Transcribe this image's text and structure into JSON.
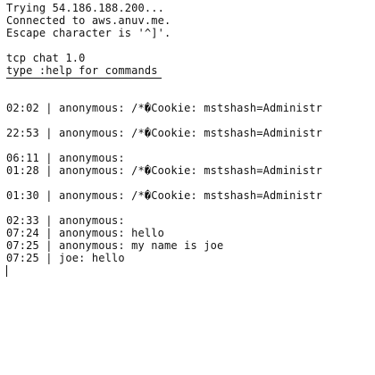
{
  "connection": {
    "trying": "Trying 54.186.188.200...",
    "connected": "Connected to aws.anuv.me.",
    "escape": "Escape character is '^]'."
  },
  "banner": {
    "title": "tcp chat 1.0",
    "help": "type :help for commands"
  },
  "messages": [
    {
      "text": "02:02 | anonymous: /*�Cookie: mstshash=Administr"
    },
    {
      "text": "22:53 | anonymous: /*�Cookie: mstshash=Administr"
    },
    {
      "text": "06:11 | anonymous:"
    },
    {
      "text": "01:28 | anonymous: /*�Cookie: mstshash=Administr"
    },
    {
      "text": "01:30 | anonymous: /*�Cookie: mstshash=Administr"
    },
    {
      "text": "02:33 | anonymous:"
    },
    {
      "text": "07:24 | anonymous: hello"
    },
    {
      "text": "07:25 | anonymous: my name is joe"
    },
    {
      "text": "07:25 | joe: hello"
    }
  ]
}
